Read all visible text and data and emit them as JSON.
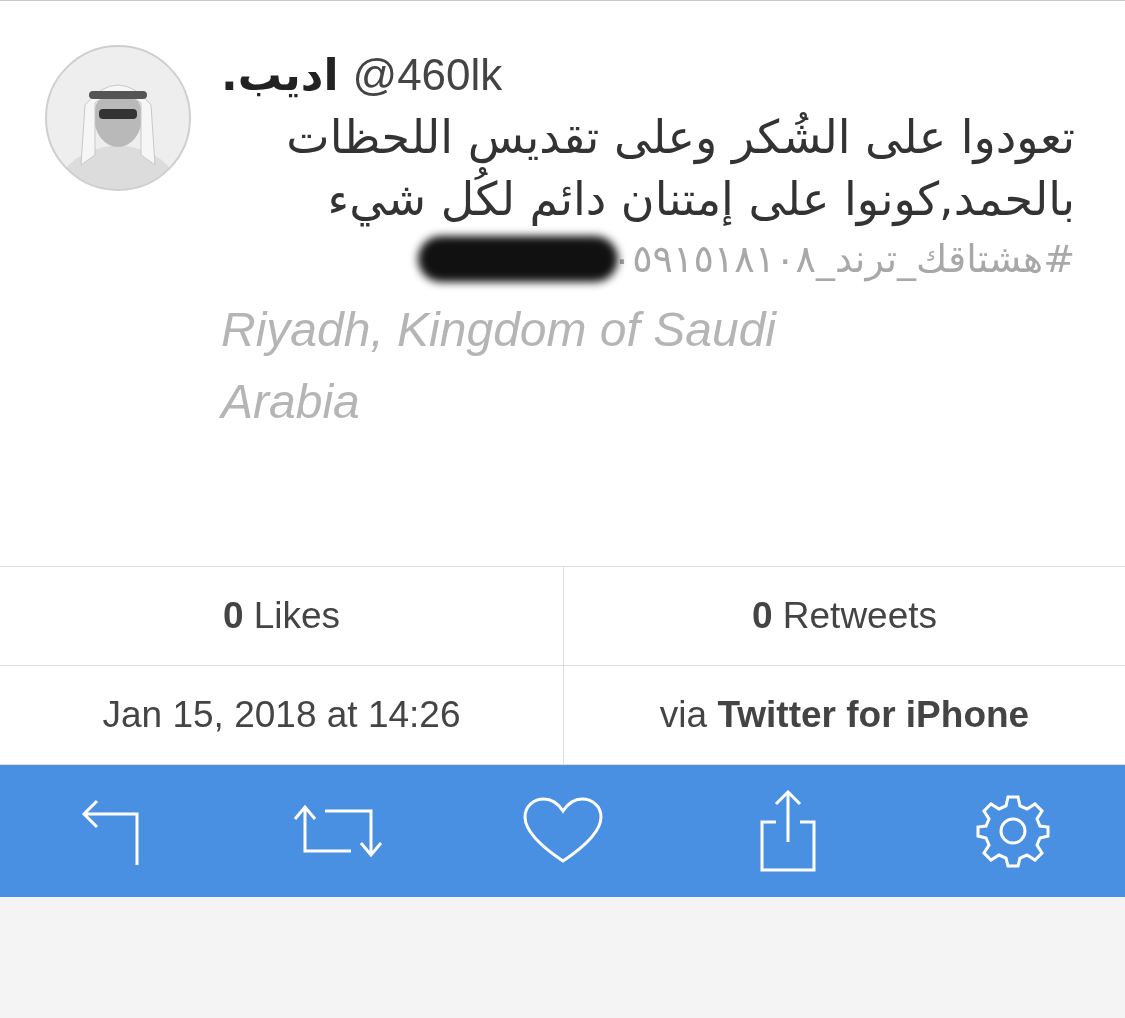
{
  "tweet": {
    "name": "اديب.",
    "handle": "@460lk",
    "text": "تعودوا على الشُكر وعلى تقديس اللحظات بالحمد,كونوا على إمتنان دائم لكُل شيء",
    "hashtag": "#هشتاقك_ترند_٠٥٩١٥١٨١٠٨",
    "location": "Riyadh, Kingdom of Saudi Arabia"
  },
  "stats": {
    "likes": "**0** Likes",
    "retweets": "**0** Retweets",
    "timestamp": "Jan 15, 2018 at 14:26",
    "source": "via **Twitter for iPhone**"
  },
  "toolbar": [
    {
      "kind": "reply"
    },
    {
      "kind": "retweet"
    },
    {
      "kind": "like"
    },
    {
      "kind": "share"
    },
    {
      "kind": "settings"
    }
  ]
}
